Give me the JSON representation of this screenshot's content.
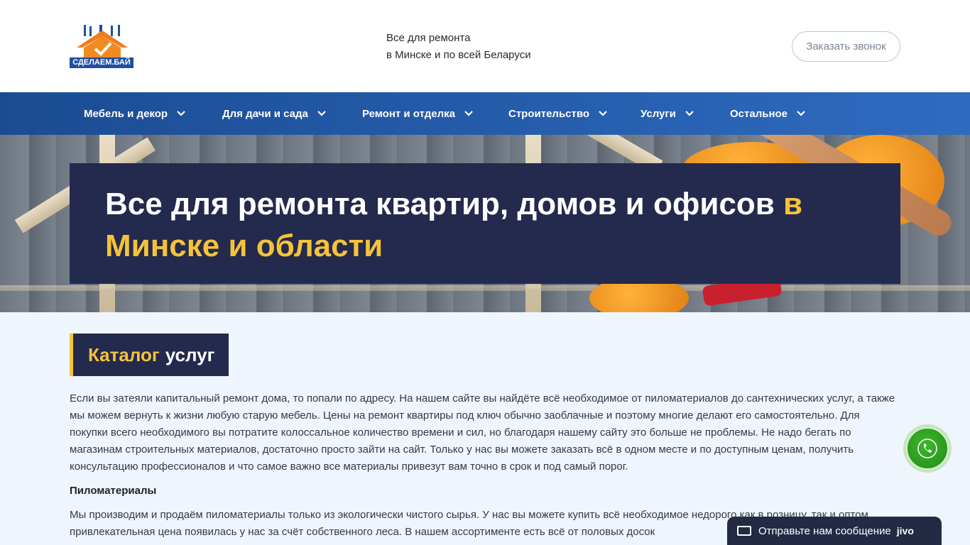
{
  "header": {
    "logo_text": "СДЕЛАЕМ.БАЙ",
    "tagline_line1": "Все для ремонта",
    "tagline_line2": "в Минске и по всей Беларуси",
    "callback_label": "Заказать звонок"
  },
  "nav": {
    "items": [
      {
        "label": "Мебель и декор"
      },
      {
        "label": "Для дачи и сада"
      },
      {
        "label": "Ремонт и отделка"
      },
      {
        "label": "Строительство"
      },
      {
        "label": "Услуги"
      },
      {
        "label": "Остальное"
      }
    ]
  },
  "hero": {
    "title_main": "Все для ремонта квартир, домов и офисов ",
    "title_accent": "в Минске и области"
  },
  "catalog": {
    "heading_accent": "Каталог",
    "heading_rest": "услуг"
  },
  "content": {
    "intro": "Если вы затеяли капитальный ремонт дома, то попали по адресу. На нашем сайте вы найдёте всё необходимое от пиломатериалов до сантехнических услуг, а также мы можем вернуть к жизни любую старую мебель. Цены на ремонт квартиры под ключ обычно заоблачные и поэтому многие делают его самостоятельно. Для покупки всего необходимого вы потратите колоссальное количество времени и сил, но благодаря нашему сайту это больше не проблемы. Не надо бегать по магазинам строительных материалов, достаточно просто зайти на сайт. Только у нас вы можете заказать всё в одном месте и по доступным ценам, получить консультацию профессионалов и что самое важно все материалы привезут вам точно в срок и под самый порог.",
    "section_title": "Пиломатериалы",
    "section_text": "Мы производим и продаём пиломатериалы только из экологически чистого сырья. У нас вы можете купить всё необходимое недорого как в розницу, так и оптом, привлекательная цена появилась у нас за счёт собственного леса. В нашем ассортименте есть всё от половых досок"
  },
  "widgets": {
    "chat_label": "Отправьте нам сообщение",
    "chat_brand": "jivo"
  },
  "colors": {
    "accent_yellow": "#f6c338",
    "dark_navy": "#232a4e",
    "nav_blue": "#1b4c93",
    "call_green": "#2ea81f"
  }
}
